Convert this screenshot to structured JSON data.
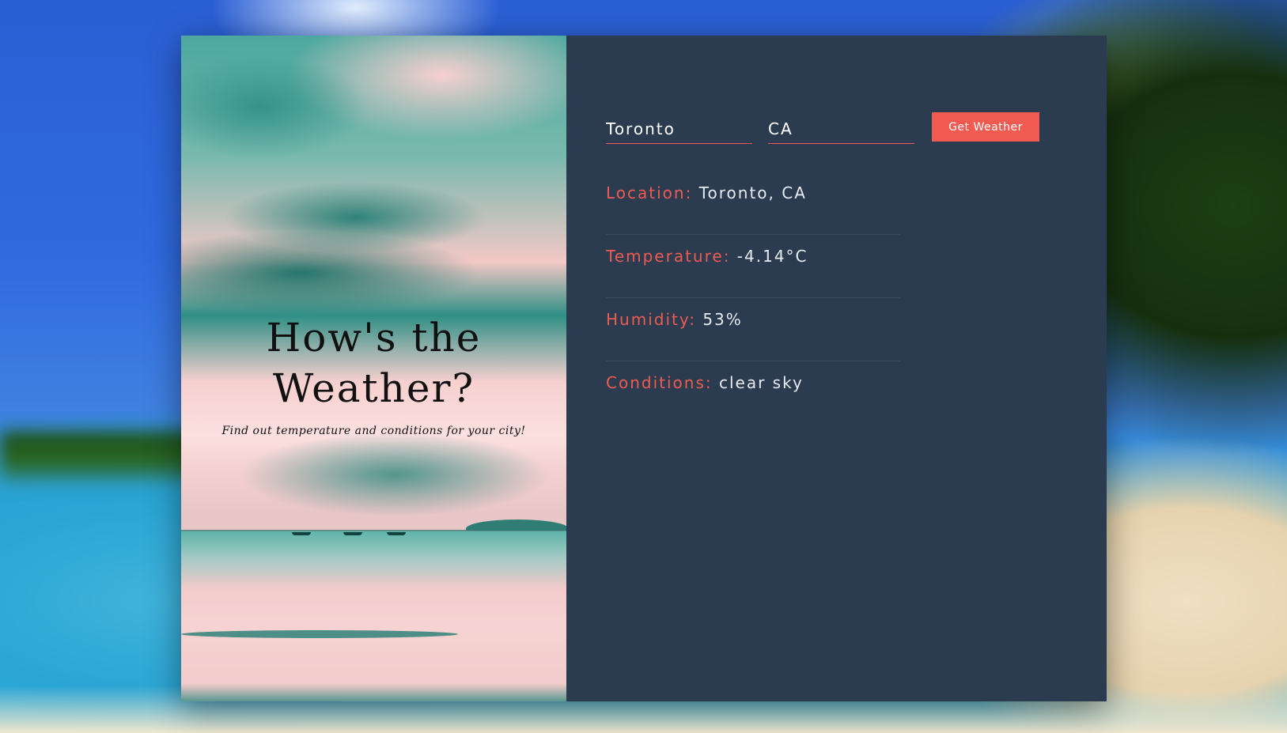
{
  "colors": {
    "accent": "#f05a50",
    "panel_bg": "#2c3c50",
    "value_text": "#e7ebef"
  },
  "hero": {
    "title": "How's the Weather?",
    "subtitle": "Find out temperature and conditions for your city!"
  },
  "form": {
    "city_value": "Toronto",
    "country_value": "CA",
    "submit_label": "Get Weather"
  },
  "results": {
    "location": {
      "label": "Location:",
      "value": "Toronto, CA"
    },
    "temperature": {
      "label": "Temperature:",
      "value": "-4.14°C"
    },
    "humidity": {
      "label": "Humidity:",
      "value": "53%"
    },
    "conditions": {
      "label": "Conditions:",
      "value": "clear sky"
    }
  }
}
